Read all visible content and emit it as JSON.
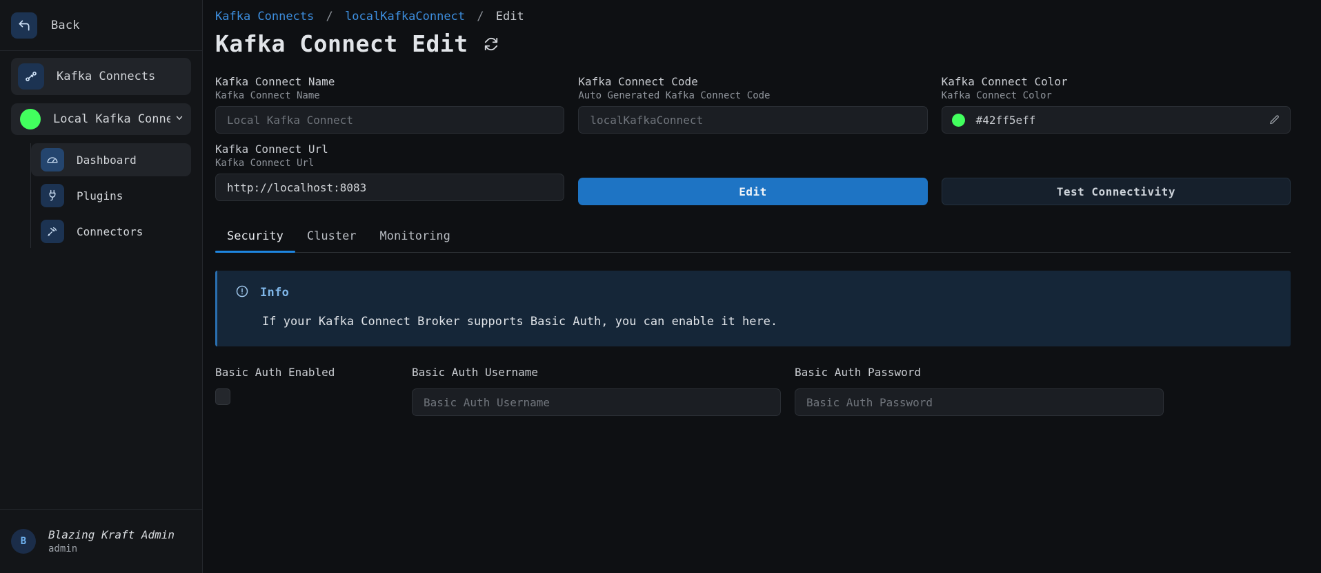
{
  "sidebar": {
    "back": {
      "label": "Back",
      "icon": "back-arrow-icon"
    },
    "top_nav": {
      "label": "Kafka Connects",
      "icon": "kafka-connects-icon"
    },
    "cluster": {
      "label": "Local Kafka Conne…",
      "status_color": "#42ff5e",
      "chevron": "⌄"
    },
    "items": [
      {
        "label": "Dashboard",
        "icon": "gauge-icon",
        "active": true
      },
      {
        "label": "Plugins",
        "icon": "plug-icon",
        "active": false
      },
      {
        "label": "Connectors",
        "icon": "antenna-icon",
        "active": false
      }
    ],
    "user": {
      "initial": "B",
      "name": "Blazing Kraft Admin",
      "role": "admin"
    }
  },
  "breadcrumb": {
    "items": [
      "Kafka Connects",
      "localKafkaConnect",
      "Edit"
    ],
    "separator": "/"
  },
  "header": {
    "title": "Kafka Connect Edit",
    "refresh_icon": "refresh-icon"
  },
  "form": {
    "name": {
      "label": "Kafka Connect Name",
      "hint": "Kafka Connect Name",
      "placeholder": "Local Kafka Connect",
      "value": ""
    },
    "code": {
      "label": "Kafka Connect Code",
      "hint": "Auto Generated Kafka Connect Code",
      "placeholder": "localKafkaConnect",
      "value": ""
    },
    "color": {
      "label": "Kafka Connect Color",
      "hint": "Kafka Connect Color",
      "value": "#42ff5eff",
      "swatch": "#42ff5e",
      "edit_icon": "pencil-icon"
    },
    "url": {
      "label": "Kafka Connect Url",
      "hint": "Kafka Connect Url",
      "placeholder": "http://localhost:8083",
      "value": "http://localhost:8083"
    },
    "edit_button": "Edit",
    "test_button": "Test Connectivity"
  },
  "tabs": [
    {
      "label": "Security",
      "active": true
    },
    {
      "label": "Cluster",
      "active": false
    },
    {
      "label": "Monitoring",
      "active": false
    }
  ],
  "info": {
    "icon": "info-circle-icon",
    "title": "Info",
    "text": "If your Kafka Connect Broker supports Basic Auth, you can enable it here."
  },
  "basic_auth": {
    "enabled_label": "Basic Auth Enabled",
    "enabled_checked": false,
    "username_label": "Basic Auth Username",
    "username_placeholder": "Basic Auth Username",
    "username_value": "",
    "password_label": "Basic Auth Password",
    "password_placeholder": "Basic Auth Password",
    "password_value": ""
  },
  "colors": {
    "accent": "#1e86e0",
    "primary_button": "#1e74c4",
    "status_green": "#42ff5e",
    "info_bg": "#152638",
    "sidebar_bg": "#131518",
    "page_bg": "#0e1013"
  }
}
